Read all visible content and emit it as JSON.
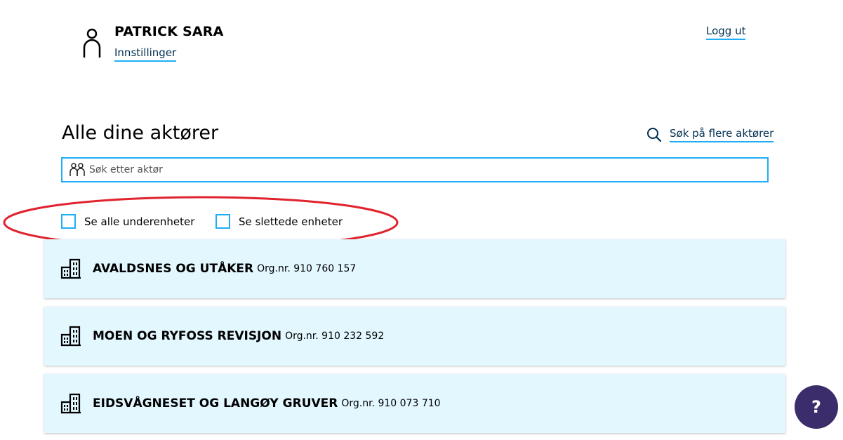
{
  "header": {
    "user_name": "PATRICK SARA",
    "settings_label": "Innstillinger",
    "logout_label": "Logg ut",
    "icons": {
      "user": "person-icon"
    }
  },
  "main": {
    "title": "Alle dine aktører",
    "search_more_label": "Søk på flere aktører",
    "search": {
      "placeholder": "Søk etter aktør",
      "value": ""
    },
    "filters": [
      {
        "label": "Se alle underenheter",
        "checked": false
      },
      {
        "label": "Se slettede enheter",
        "checked": false
      }
    ],
    "actors": [
      {
        "name": "AVALDSNES OG UTÅKER",
        "org": "Org.nr. 910 760 157"
      },
      {
        "name": "MOEN OG RYFOSS REVISJON",
        "org": "Org.nr. 910 232 592"
      },
      {
        "name": "EIDSVÅGNESET OG LANGØY GRUVER",
        "org": "Org.nr. 910 073 710"
      }
    ]
  },
  "help": {
    "label": "?"
  },
  "colors": {
    "accent": "#1eaef7",
    "card_background": "#e3f7ff",
    "help_button": "#3b2c6b",
    "annotation": "#e0232e",
    "link_text": "#022f51"
  }
}
